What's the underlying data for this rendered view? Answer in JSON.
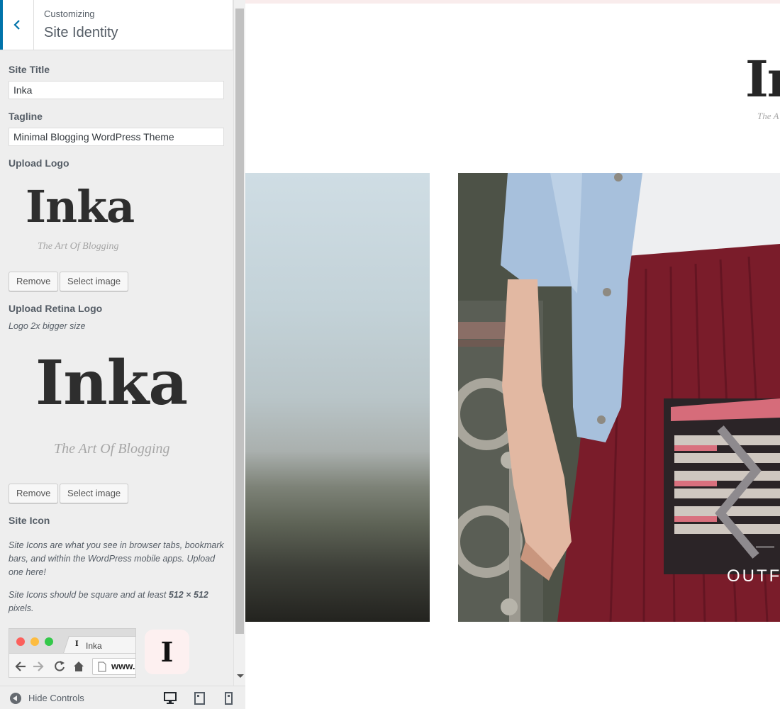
{
  "header": {
    "kicker": "Customizing",
    "title": "Site Identity"
  },
  "site_title": {
    "label": "Site Title",
    "value": "Inka"
  },
  "tagline": {
    "label": "Tagline",
    "value": "Minimal Blogging WordPress Theme"
  },
  "upload_logo": {
    "label": "Upload Logo",
    "logo_word": "Inka",
    "logo_tagline": "The Art Of Blogging",
    "remove_label": "Remove",
    "select_label": "Select image"
  },
  "upload_retina_logo": {
    "label": "Upload Retina Logo",
    "description": "Logo 2x bigger size",
    "logo_word": "Inka",
    "logo_tagline": "The Art Of Blogging",
    "remove_label": "Remove",
    "select_label": "Select image"
  },
  "site_icon": {
    "label": "Site Icon",
    "description_1": "Site Icons are what you see in browser tabs, bookmark bars, and within the WordPress mobile apps. Upload one here!",
    "description_2_prefix": "Site Icons should be square and at least ",
    "description_2_size": "512 × 512",
    "description_2_suffix": " pixels.",
    "browser_tab_label": "Inka",
    "browser_tab_favicon": "I",
    "browser_url": "www.",
    "icon_letter": "I"
  },
  "footer": {
    "hide_controls_label": "Hide Controls",
    "devices": [
      "desktop-icon",
      "tablet-icon",
      "mobile-icon"
    ]
  },
  "preview": {
    "logo": "In",
    "tagline": "The A",
    "post_category": "OUTF"
  },
  "colors": {
    "accent": "#0073aa",
    "panel_bg": "#eeeeee",
    "preview_topbar": "#f9ecec",
    "site_icon_bg": "#fdf0f0"
  }
}
